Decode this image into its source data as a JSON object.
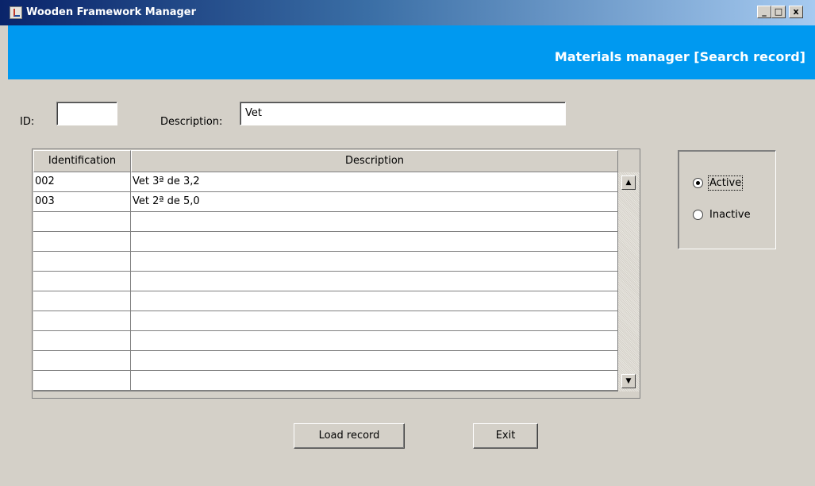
{
  "window": {
    "title": "Wooden Framework Manager",
    "controls": {
      "minimize": "_",
      "maximize": "□",
      "close": "x"
    }
  },
  "banner": {
    "title": "Materials manager [Search record]"
  },
  "search": {
    "id_label": "ID:",
    "id_value": "",
    "description_label": "Description:",
    "description_value": "Vet"
  },
  "table": {
    "columns": [
      "Identification",
      "Description"
    ],
    "rows": [
      [
        "002",
        "Vet 3ª de 3,2"
      ],
      [
        "003",
        "Vet 2ª de 5,0"
      ],
      [
        "",
        ""
      ],
      [
        "",
        ""
      ],
      [
        "",
        ""
      ],
      [
        "",
        ""
      ],
      [
        "",
        ""
      ],
      [
        "",
        ""
      ],
      [
        "",
        ""
      ],
      [
        "",
        ""
      ],
      [
        "",
        ""
      ]
    ]
  },
  "status": {
    "options": [
      {
        "label": "Active",
        "selected": true
      },
      {
        "label": "Inactive",
        "selected": false
      }
    ]
  },
  "buttons": {
    "load": "Load record",
    "exit": "Exit"
  },
  "icons": {
    "app": "java-cup-icon",
    "scroll_up": "up-arrow-icon",
    "scroll_down": "down-arrow-icon"
  },
  "colors": {
    "banner": "#0099f0",
    "background": "#d4d0c8"
  }
}
